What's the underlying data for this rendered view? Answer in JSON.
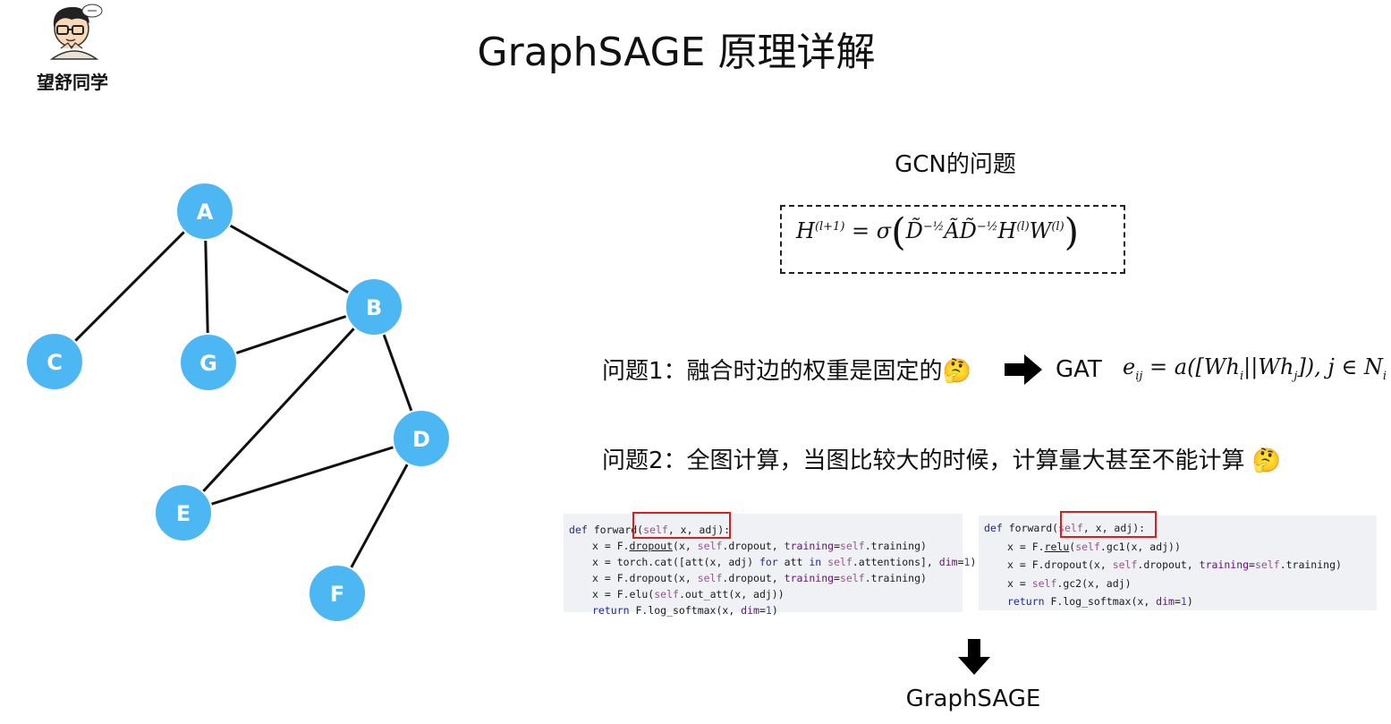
{
  "header": {
    "title": "GraphSAGE 原理详解",
    "author": "望舒同学",
    "avatar_icon": "cartoon-avatar-icon"
  },
  "graph": {
    "node_color": "#4db7f4",
    "edge_color": "#111111",
    "nodes": [
      {
        "id": "A"
      },
      {
        "id": "B"
      },
      {
        "id": "C"
      },
      {
        "id": "G"
      },
      {
        "id": "D"
      },
      {
        "id": "E"
      },
      {
        "id": "F"
      }
    ],
    "edges": [
      [
        "A",
        "C"
      ],
      [
        "A",
        "G"
      ],
      [
        "A",
        "B"
      ],
      [
        "G",
        "B"
      ],
      [
        "B",
        "D"
      ],
      [
        "B",
        "E"
      ],
      [
        "E",
        "D"
      ],
      [
        "D",
        "F"
      ]
    ]
  },
  "gcn": {
    "title": "GCN的问题",
    "formula": {
      "lhs": "H",
      "lhs_sup": "(l+1)",
      "eq": "=",
      "sigma": "σ",
      "open": "(",
      "d1": "D̃",
      "d1_sup": "−½",
      "a": "Ã",
      "d2": "D̃",
      "d2_sup": "−½",
      "h": "H",
      "h_sup": "(l)",
      "w": "W",
      "w_sup": "(l)",
      "close": ")"
    }
  },
  "problems": {
    "p1": {
      "text": "问题1：融合时边的权重是固定的🤔",
      "target": "GAT",
      "formula": {
        "e": "e",
        "e_sub": "ij",
        "body": " = a([Wh",
        "sub_i": "i",
        "mid": "||Wh",
        "sub_j": "j",
        "tail": "]), j ∈ N",
        "sub_i2": "i"
      }
    },
    "p2": {
      "text": "问题2：全图计算，当图比较大的时候，计算量大甚至不能计算 🤔"
    }
  },
  "code_gat": {
    "l1_kw": "def",
    "l1_fn": " forward",
    "l1_paren": "(",
    "l1_self": "self",
    "l1_rest": ", x, adj):",
    "l2_a": "x = F.",
    "l2_fn": "dropout",
    "l2_b": "(x, ",
    "l2_self1": "self",
    "l2_c": ".dropout, ",
    "l2_kw": "training",
    "l2_d": "=",
    "l2_self2": "self",
    "l2_e": ".training)",
    "l3_a": "x = torch.cat([att(x, adj) ",
    "l3_for": "for",
    "l3_b": " att ",
    "l3_in": "in",
    "l3_c": " ",
    "l3_self": "self",
    "l3_d": ".attentions], ",
    "l3_kw": "dim",
    "l3_e": "=",
    "l3_num": "1",
    "l3_f": ")",
    "l4_a": "x = F.dropout(x, ",
    "l4_self1": "self",
    "l4_b": ".dropout, ",
    "l4_kw": "training",
    "l4_c": "=",
    "l4_self2": "self",
    "l4_d": ".training)",
    "l5_a": "x = F.elu(",
    "l5_self": "self",
    "l5_b": ".out_att(x, adj))",
    "l6_ret": "return",
    "l6_a": " F.log_softmax(x, ",
    "l6_kw": "dim",
    "l6_b": "=",
    "l6_num": "1",
    "l6_c": ")"
  },
  "code_gcn": {
    "l1_kw": "def",
    "l1_fn": " forward",
    "l1_paren": "(",
    "l1_self": "self",
    "l1_rest": ", x, adj):",
    "l2_a": "x = F.",
    "l2_fn": "relu",
    "l2_b": "(",
    "l2_self": "self",
    "l2_c": ".gc1(x, adj))",
    "l3_a": "x = F.dropout(x, ",
    "l3_self1": "self",
    "l3_b": ".dropout, ",
    "l3_kw": "training",
    "l3_c": "=",
    "l3_self2": "self",
    "l3_d": ".training)",
    "l4_a": "x = ",
    "l4_self": "self",
    "l4_b": ".gc2(x, adj)",
    "l5_ret": "return",
    "l5_a": " F.log_softmax(x, ",
    "l5_kw": "dim",
    "l5_b": "=",
    "l5_num": "1",
    "l5_c": ")"
  },
  "result": {
    "label": "GraphSAGE"
  }
}
